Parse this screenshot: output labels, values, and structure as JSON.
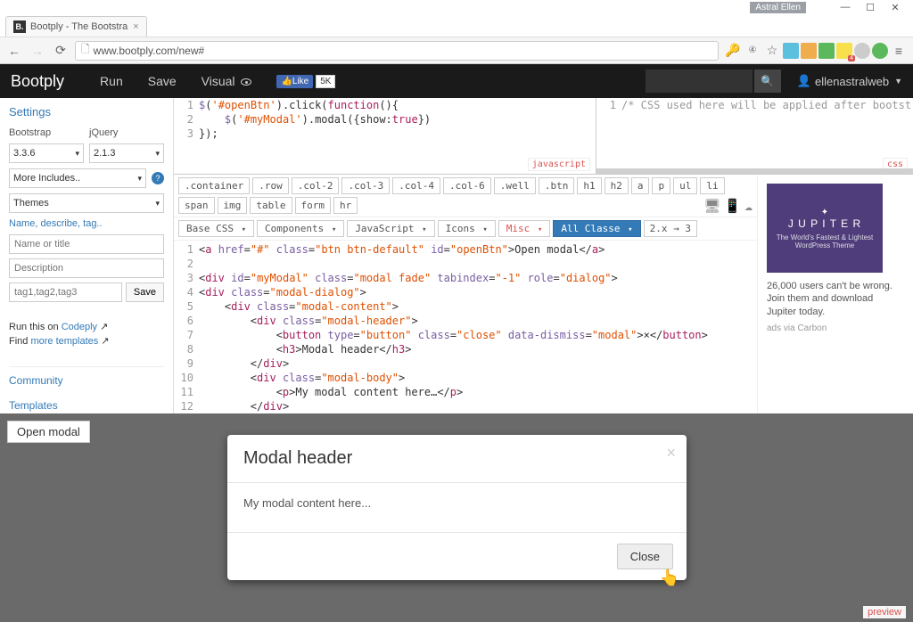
{
  "window": {
    "user_label": "Astral Ellen"
  },
  "browser": {
    "tab_title": "Bootply - The Bootstra",
    "url": "www.bootply.com/new#"
  },
  "nav": {
    "logo": "Bootply",
    "run": "Run",
    "save": "Save",
    "visual": "Visual",
    "fb_like": "Like",
    "fb_count": "5K",
    "username": "ellenastralweb"
  },
  "sidebar": {
    "heading": "Settings",
    "bootstrap_label": "Bootstrap",
    "jquery_label": "jQuery",
    "bootstrap_ver": "3.3.6",
    "jquery_ver": "2.1.3",
    "more_includes": "More Includes..",
    "themes": "Themes",
    "name_describe": "Name, describe, tag..",
    "name_ph": "Name or title",
    "desc_ph": "Description",
    "tags_ph": "tag1,tag2,tag3",
    "save_btn": "Save",
    "run_on": "Run this on ",
    "codeply": "Codeply",
    "find_more": "Find ",
    "more_templates": "more templates",
    "community": "Community",
    "templates": "Templates"
  },
  "js_pane": {
    "label": "javascript",
    "lines": [
      "$('#openBtn').click(function(){",
      "    $('#myModal').modal({show:true})",
      "});"
    ]
  },
  "css_pane": {
    "label": "css",
    "comment": "/* CSS used here will be applied after bootstrap."
  },
  "html_toolbar": {
    "row1": [
      ".container",
      ".row",
      ".col-2",
      ".col-3",
      ".col-4",
      ".col-6",
      ".well",
      ".btn",
      "h1",
      "h2",
      "a",
      "p",
      "ul",
      "li",
      "span",
      "img",
      "table",
      "form",
      "hr"
    ],
    "base_css": "Base CSS",
    "components": "Components",
    "javascript": "JavaScript",
    "icons": "Icons",
    "misc": "Misc",
    "all_classes": "All Classe",
    "version": "2.x → 3"
  },
  "html_pane": {
    "lines_rendered": true
  },
  "ad": {
    "brand": "J U P I T E R",
    "subtitle": "The World's Fastest & Lightest WordPress Theme",
    "caption": "26,000 users can't be wrong. Join them and download Jupiter today.",
    "source": "ads via Carbon"
  },
  "preview": {
    "open_modal": "Open modal",
    "label": "preview",
    "modal_header": "Modal header",
    "modal_body": "My modal content here...",
    "close": "Close"
  }
}
